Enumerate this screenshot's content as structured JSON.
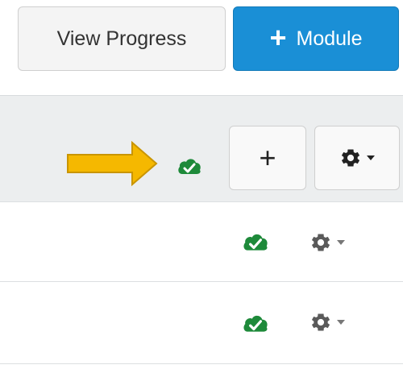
{
  "toolbar": {
    "view_progress_label": "View Progress",
    "add_module_label": "Module",
    "add_module_plus": "+"
  },
  "module_header": {
    "add_item_label": "+",
    "sync_status_icon": "cloud-check-icon",
    "settings_icon": "gear-icon",
    "annotation_arrow_color": "#f5b800"
  },
  "rows": [
    {
      "sync_status_icon": "cloud-check-icon",
      "settings_icon": "gear-icon"
    },
    {
      "sync_status_icon": "cloud-check-icon",
      "settings_icon": "gear-icon"
    }
  ],
  "colors": {
    "primary": "#1a8fd6",
    "published_green": "#1e8a3a",
    "header_bg": "#eceeef"
  }
}
